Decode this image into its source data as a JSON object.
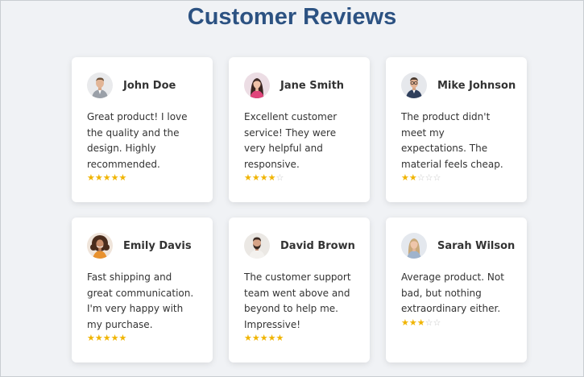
{
  "title": "Customer Reviews",
  "colors": {
    "accent": "#2c5282",
    "star": "#f0b400",
    "star_empty": "#c8c8c8"
  },
  "reviews": [
    {
      "name": "John Doe",
      "avatar": "avatar-man-gray-suit",
      "text": "Great product! I love the quality and the design. Highly recommended.",
      "rating": 5,
      "stars_filled": "★★★★★",
      "stars_empty": ""
    },
    {
      "name": "Jane Smith",
      "avatar": "avatar-woman-dark-hair",
      "text": "Excellent customer service! They were very helpful and responsive.",
      "rating": 4,
      "stars_filled": "★★★★",
      "stars_empty": "☆"
    },
    {
      "name": "Mike Johnson",
      "avatar": "avatar-man-glasses",
      "text": "The product didn't meet my expectations. The material feels cheap.",
      "rating": 2,
      "stars_filled": "★★",
      "stars_empty": "☆☆☆"
    },
    {
      "name": "Emily Davis",
      "avatar": "avatar-woman-curly-hair",
      "text": "Fast shipping and great communication. I'm very happy with my purchase.",
      "rating": 5,
      "stars_filled": "★★★★★",
      "stars_empty": ""
    },
    {
      "name": "David Brown",
      "avatar": "avatar-man-beard",
      "text": "The customer support team went above and beyond to help me. Impressive!",
      "rating": 5,
      "stars_filled": "★★★★★",
      "stars_empty": ""
    },
    {
      "name": "Sarah Wilson",
      "avatar": "avatar-woman-blonde",
      "text": "Average product. Not bad, but nothing extraordinary either.",
      "rating": 3,
      "stars_filled": "★★★",
      "stars_empty": "☆☆"
    }
  ]
}
